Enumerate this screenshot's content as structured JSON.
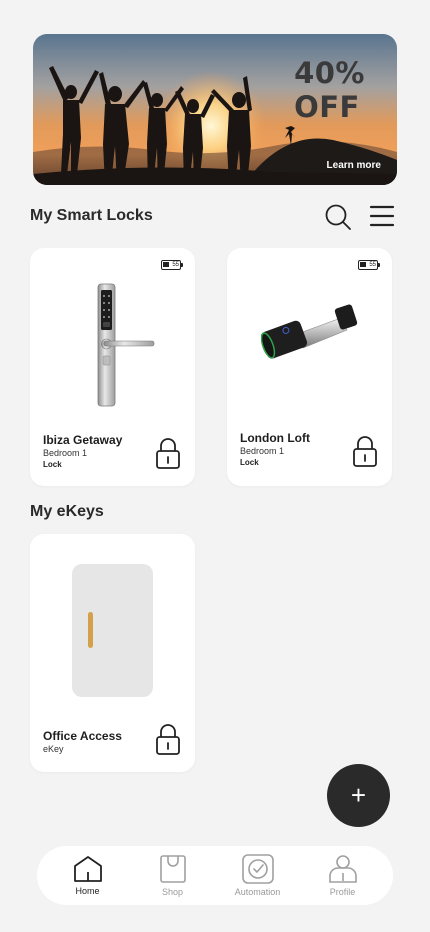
{
  "banner": {
    "discount_line1": "40%",
    "discount_line2": "OFF",
    "link_label": "Learn more"
  },
  "smart_locks": {
    "title": "My Smart Locks",
    "items": [
      {
        "name": "Ibiza Getaway",
        "room": "Bedroom 1",
        "status": "Lock",
        "battery": "55"
      },
      {
        "name": "London Loft",
        "room": "Bedroom 1",
        "status": "Lock",
        "battery": "55"
      }
    ]
  },
  "ekeys": {
    "title": "My eKeys",
    "items": [
      {
        "name": "Office Access",
        "type": "eKey"
      }
    ]
  },
  "fab": {
    "label": "+"
  },
  "nav": {
    "items": [
      {
        "label": "Home",
        "icon": "home-icon"
      },
      {
        "label": "Shop",
        "icon": "shopping-bag-icon"
      },
      {
        "label": "Automation",
        "icon": "automation-icon"
      },
      {
        "label": "Profile",
        "icon": "profile-icon"
      }
    ]
  },
  "colors": {
    "background": "#f3f3f3",
    "card": "#ffffff",
    "accent_dark": "#2a2a2a",
    "nav_inactive": "#9a9a9a",
    "ekey_handle": "#d4a04a"
  }
}
